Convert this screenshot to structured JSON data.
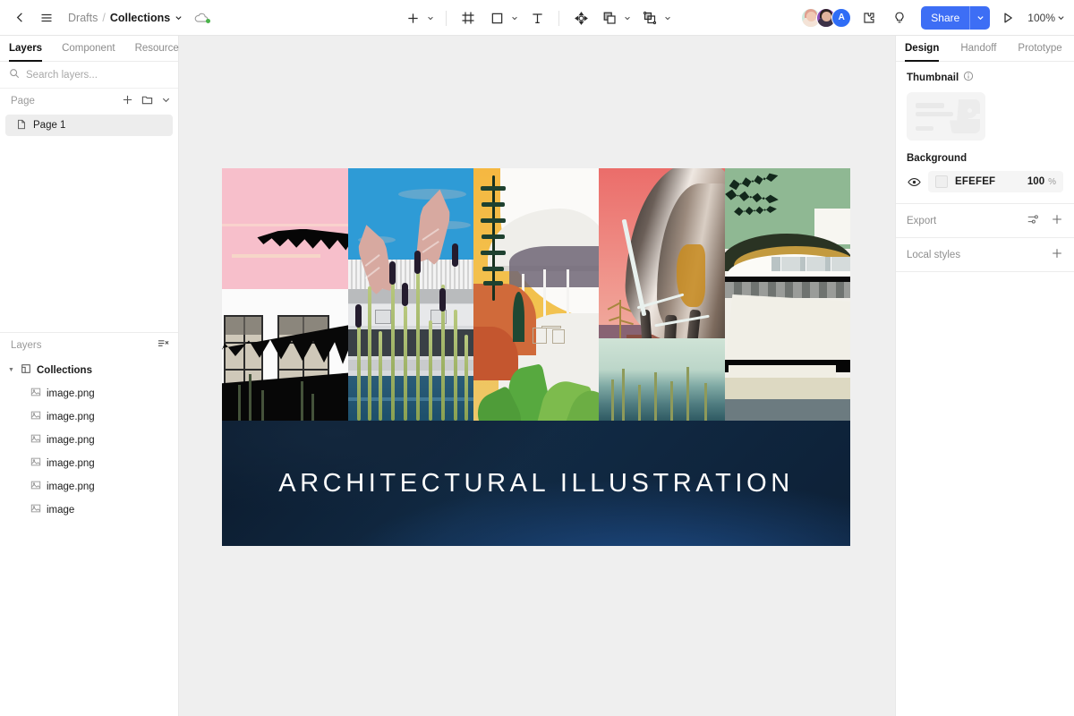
{
  "topbar": {
    "back_icon": "chevron-left-icon",
    "menu_icon": "hamburger-menu-icon",
    "breadcrumb": {
      "root": "Drafts",
      "separator": "/",
      "file": "Collections"
    },
    "cloud_icon": "cloud-sync-icon",
    "tools": [
      {
        "name": "add-tool",
        "icon": "plus-icon",
        "has_chevron": true
      },
      {
        "name": "frame-tool",
        "icon": "frame-icon",
        "has_chevron": false
      },
      {
        "name": "shape-tool",
        "icon": "square-icon",
        "has_chevron": true
      },
      {
        "name": "text-tool",
        "icon": "text-icon",
        "has_chevron": false
      },
      {
        "name": "vector-tool",
        "icon": "move-vector-icon",
        "has_chevron": false
      },
      {
        "name": "boolean-tool",
        "icon": "boolean-union-icon",
        "has_chevron": true
      },
      {
        "name": "mask-tool",
        "icon": "mask-icon",
        "has_chevron": true
      }
    ],
    "avatars": [
      {
        "name": "collaborator-1",
        "initial": ""
      },
      {
        "name": "collaborator-2",
        "initial": ""
      },
      {
        "name": "collaborator-3",
        "initial": "A"
      }
    ],
    "plugin_icon": "plugin-puzzle-icon",
    "idea_icon": "lightbulb-icon",
    "share_label": "Share",
    "present_icon": "play-present-icon",
    "zoom_level": "100%"
  },
  "left_panel": {
    "tabs": [
      {
        "label": "Layers",
        "active": true
      },
      {
        "label": "Component",
        "active": false
      },
      {
        "label": "Resource",
        "active": false
      }
    ],
    "search_placeholder": "Search layers...",
    "search_value": "",
    "page_section": {
      "title": "Page",
      "add_icon": "plus-icon",
      "folder_icon": "folder-icon",
      "collapse_icon": "chevron-down-icon"
    },
    "pages": [
      {
        "label": "Page 1",
        "selected": true,
        "icon": "page-file-icon"
      }
    ],
    "layers_section": {
      "title": "Layers",
      "collapse_all_icon": "collapse-all-icon"
    },
    "layers": [
      {
        "label": "Collections",
        "type": "frame",
        "icon": "frame-icon",
        "depth": 0,
        "expanded": true
      },
      {
        "label": "image.png",
        "type": "image",
        "icon": "image-icon",
        "depth": 1
      },
      {
        "label": "image.png",
        "type": "image",
        "icon": "image-icon",
        "depth": 1
      },
      {
        "label": "image.png",
        "type": "image",
        "icon": "image-icon",
        "depth": 1
      },
      {
        "label": "image.png",
        "type": "image",
        "icon": "image-icon",
        "depth": 1
      },
      {
        "label": "image.png",
        "type": "image",
        "icon": "image-icon",
        "depth": 1
      },
      {
        "label": "image",
        "type": "image",
        "icon": "image-icon",
        "depth": 1
      }
    ]
  },
  "canvas": {
    "background_color": "#EFEFEF",
    "artboard": {
      "name": "Collections",
      "banner_title": "ARCHITECTURAL ILLUSTRATION",
      "images": [
        {
          "name": "image-1",
          "description": "pink sky with black palm frond over white modernist building with grid windows"
        },
        {
          "name": "image-2",
          "description": "blue sky with pink palm fronds, slatted facade, reeds and pool"
        },
        {
          "name": "image-3",
          "description": "golden sky with curved white modernist pavilion and pine trees"
        },
        {
          "name": "image-4",
          "description": "coral sky with sweeping dark curved structure over water"
        },
        {
          "name": "image-5",
          "description": "green sky with dark palm leaves and white curved modernist building"
        }
      ]
    }
  },
  "right_panel": {
    "tabs": [
      {
        "label": "Design",
        "active": true
      },
      {
        "label": "Handoff",
        "active": false
      },
      {
        "label": "Prototype",
        "active": false
      }
    ],
    "thumbnail": {
      "label": "Thumbnail",
      "info_icon": "info-icon"
    },
    "background": {
      "label": "Background",
      "visibility_icon": "eye-icon",
      "color_hex": "EFEFEF",
      "color_value": "#EFEFEF",
      "opacity": "100",
      "opacity_unit": "%"
    },
    "export": {
      "label": "Export",
      "settings_icon": "sliders-icon",
      "add_icon": "plus-icon"
    },
    "local_styles": {
      "label": "Local styles",
      "add_icon": "plus-icon"
    }
  }
}
